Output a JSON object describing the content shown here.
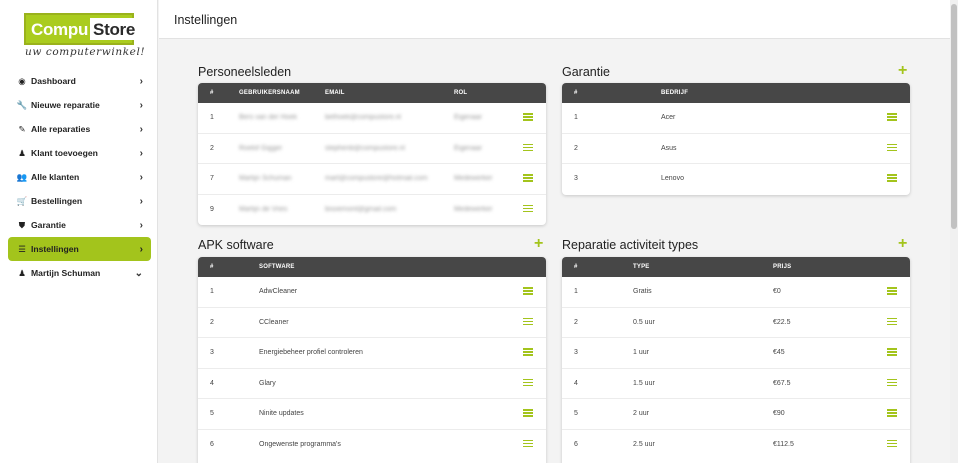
{
  "logo": {
    "part1": "Compu",
    "part2": "Store",
    "tagline": "uw computerwinkel!"
  },
  "nav": [
    {
      "label": "Dashboard",
      "icon": "gauge-icon",
      "glyph": "◉",
      "chevron": "›"
    },
    {
      "label": "Nieuwe reparatie",
      "icon": "wrench-icon",
      "glyph": "🔧",
      "chevron": "›"
    },
    {
      "label": "Alle reparaties",
      "icon": "screwdriver-icon",
      "glyph": "✎",
      "chevron": "›"
    },
    {
      "label": "Klant toevoegen",
      "icon": "person-icon",
      "glyph": "♟",
      "chevron": "›"
    },
    {
      "label": "Alle klanten",
      "icon": "users-icon",
      "glyph": "👥",
      "chevron": "›"
    },
    {
      "label": "Bestellingen",
      "icon": "cart-icon",
      "glyph": "🛒",
      "chevron": "›"
    },
    {
      "label": "Garantie",
      "icon": "shield-icon",
      "glyph": "⛊",
      "chevron": "›"
    },
    {
      "label": "Instellingen",
      "icon": "sliders-icon",
      "glyph": "☰",
      "chevron": "›",
      "active": true
    },
    {
      "label": "Martijn Schuman",
      "icon": "person-icon",
      "glyph": "♟",
      "chevron": "⌄"
    }
  ],
  "page_title": "Instellingen",
  "accent": "#a3c41c",
  "personeel": {
    "title": "Personeelsleden",
    "headers": [
      "#",
      "GEBRUIKERSNAAM",
      "EMAIL",
      "ROL"
    ],
    "rows": [
      [
        "1",
        "Bers van der Hoek",
        "bethoek@compustore.nl",
        "Eigenaar"
      ],
      [
        "2",
        "Roelof Gigger",
        "stephenb@compustore.nl",
        "Eigenaar"
      ],
      [
        "7",
        "Martijn Schuman",
        "mart@compustore@hotmail.com",
        "Medewerker"
      ],
      [
        "9",
        "Martijn de Vries",
        "bisoemont@gmail.com",
        "Medewerker"
      ]
    ]
  },
  "garantie": {
    "title": "Garantie",
    "headers": [
      "#",
      "BEDRIJF"
    ],
    "rows": [
      [
        "1",
        "Acer"
      ],
      [
        "2",
        "Asus"
      ],
      [
        "3",
        "Lenovo"
      ]
    ]
  },
  "apk": {
    "title": "APK software",
    "headers": [
      "#",
      "SOFTWARE"
    ],
    "rows": [
      [
        "1",
        "AdwCleaner"
      ],
      [
        "2",
        "CCleaner"
      ],
      [
        "3",
        "Energiebeheer profiel controleren"
      ],
      [
        "4",
        "Glary"
      ],
      [
        "5",
        "Ninite updates"
      ],
      [
        "6",
        "Ongewenste programma's"
      ]
    ]
  },
  "reparatie": {
    "title": "Reparatie activiteit types",
    "headers": [
      "#",
      "TYPE",
      "PRIJS"
    ],
    "rows": [
      [
        "1",
        "Gratis",
        "€0"
      ],
      [
        "2",
        "0.5 uur",
        "€22.5"
      ],
      [
        "3",
        "1 uur",
        "€45"
      ],
      [
        "4",
        "1.5 uur",
        "€67.5"
      ],
      [
        "5",
        "2 uur",
        "€90"
      ],
      [
        "6",
        "2.5 uur",
        "€112.5"
      ]
    ]
  },
  "plus_glyph": "+"
}
